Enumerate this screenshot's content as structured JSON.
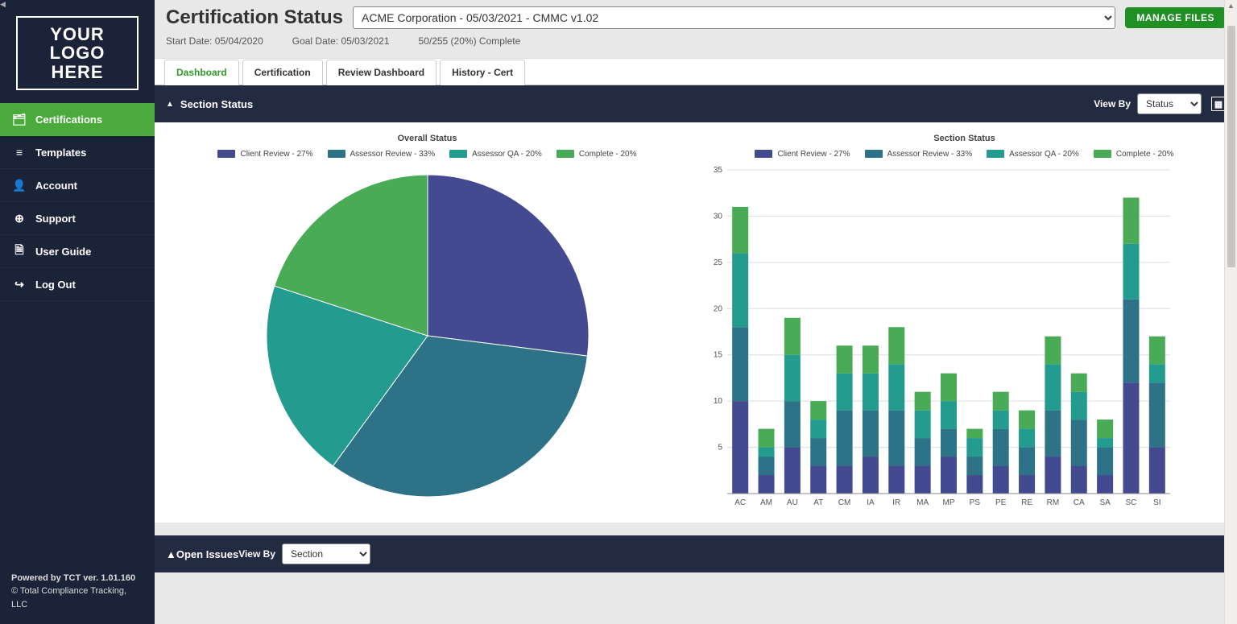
{
  "colors": {
    "client_review": "#434a8f",
    "assessor_review": "#2d7286",
    "assessor_qa": "#239b8f",
    "complete": "#4aab57"
  },
  "logo": {
    "line1": "YOUR",
    "line2": "LOGO",
    "line3": "HERE"
  },
  "sidebar": {
    "items": [
      {
        "icon": "certifications-icon",
        "label": "Certifications",
        "active": true
      },
      {
        "icon": "templates-icon",
        "label": "Templates",
        "active": false
      },
      {
        "icon": "account-icon",
        "label": "Account",
        "active": false
      },
      {
        "icon": "support-icon",
        "label": "Support",
        "active": false
      },
      {
        "icon": "user-guide-icon",
        "label": "User Guide",
        "active": false
      },
      {
        "icon": "log-out-icon",
        "label": "Log Out",
        "active": false
      }
    ],
    "footer": {
      "powered": "Powered by TCT ver. 1.01.160",
      "copyright": "© Total Compliance Tracking, LLC"
    }
  },
  "header": {
    "title": "Certification Status",
    "selectValue": "ACME Corporation - 05/03/2021 - CMMC v1.02",
    "manageFiles": "MANAGE FILES"
  },
  "meta": {
    "startLabel": "Start Date: 05/04/2020",
    "goalLabel": "Goal Date: 05/03/2021",
    "progressLabel": "50/255 (20%) Complete"
  },
  "tabs": [
    {
      "label": "Dashboard",
      "active": true
    },
    {
      "label": "Certification",
      "active": false
    },
    {
      "label": "Review Dashboard",
      "active": false
    },
    {
      "label": "History - Cert",
      "active": false
    }
  ],
  "sectionStatusBar": {
    "title": "Section Status",
    "viewByLabel": "View By",
    "viewBySelected": "Status"
  },
  "legend": [
    {
      "label": "Client Review - 27%",
      "key": "client_review"
    },
    {
      "label": "Assessor Review - 33%",
      "key": "assessor_review"
    },
    {
      "label": "Assessor QA - 20%",
      "key": "assessor_qa"
    },
    {
      "label": "Complete - 20%",
      "key": "complete"
    }
  ],
  "overallTitle": "Overall Status",
  "sectionTitle": "Section Status",
  "openIssues": {
    "title": "Open Issues",
    "viewByLabel": "View By",
    "viewBySelected": "Section"
  },
  "chart_data": [
    {
      "type": "pie",
      "title": "Overall Status",
      "series": [
        {
          "name": "Client Review",
          "value": 27
        },
        {
          "name": "Assessor Review",
          "value": 33
        },
        {
          "name": "Assessor QA",
          "value": 20
        },
        {
          "name": "Complete",
          "value": 20
        }
      ]
    },
    {
      "type": "bar",
      "subtype": "stacked",
      "title": "Section Status",
      "ylabel": "",
      "xlabel": "",
      "ylim": [
        0,
        35
      ],
      "yticks": [
        5,
        10,
        15,
        20,
        25,
        30,
        35
      ],
      "categories": [
        "AC",
        "AM",
        "AU",
        "AT",
        "CM",
        "IA",
        "IR",
        "MA",
        "MP",
        "PS",
        "PE",
        "RE",
        "RM",
        "CA",
        "SA",
        "SC",
        "SI"
      ],
      "series": [
        {
          "name": "Client Review",
          "key": "client_review",
          "values": [
            10,
            2,
            5,
            3,
            3,
            4,
            3,
            3,
            4,
            2,
            3,
            2,
            4,
            3,
            2,
            12,
            5
          ]
        },
        {
          "name": "Assessor Review",
          "key": "assessor_review",
          "values": [
            8,
            2,
            5,
            3,
            6,
            5,
            6,
            3,
            3,
            2,
            4,
            3,
            5,
            5,
            3,
            9,
            7
          ]
        },
        {
          "name": "Assessor QA",
          "key": "assessor_qa",
          "values": [
            8,
            1,
            5,
            2,
            4,
            4,
            5,
            3,
            3,
            2,
            2,
            2,
            5,
            3,
            1,
            6,
            2
          ]
        },
        {
          "name": "Complete",
          "key": "complete",
          "values": [
            5,
            2,
            4,
            2,
            3,
            3,
            4,
            2,
            3,
            1,
            2,
            2,
            3,
            2,
            2,
            5,
            3
          ]
        }
      ]
    }
  ]
}
